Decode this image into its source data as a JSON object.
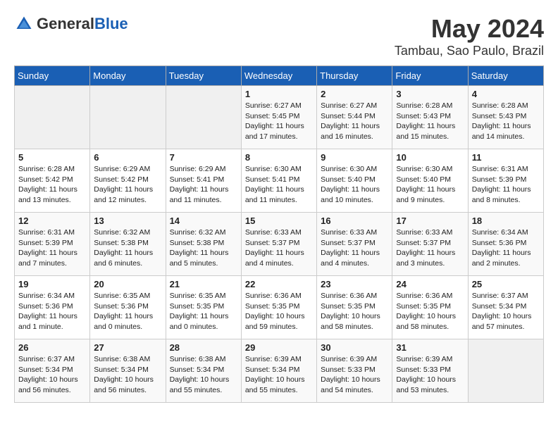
{
  "header": {
    "logo_general": "General",
    "logo_blue": "Blue",
    "month_title": "May 2024",
    "location": "Tambau, Sao Paulo, Brazil"
  },
  "days_of_week": [
    "Sunday",
    "Monday",
    "Tuesday",
    "Wednesday",
    "Thursday",
    "Friday",
    "Saturday"
  ],
  "weeks": [
    {
      "days": [
        {
          "number": "",
          "info": ""
        },
        {
          "number": "",
          "info": ""
        },
        {
          "number": "",
          "info": ""
        },
        {
          "number": "1",
          "info": "Sunrise: 6:27 AM\nSunset: 5:45 PM\nDaylight: 11 hours\nand 17 minutes."
        },
        {
          "number": "2",
          "info": "Sunrise: 6:27 AM\nSunset: 5:44 PM\nDaylight: 11 hours\nand 16 minutes."
        },
        {
          "number": "3",
          "info": "Sunrise: 6:28 AM\nSunset: 5:43 PM\nDaylight: 11 hours\nand 15 minutes."
        },
        {
          "number": "4",
          "info": "Sunrise: 6:28 AM\nSunset: 5:43 PM\nDaylight: 11 hours\nand 14 minutes."
        }
      ]
    },
    {
      "days": [
        {
          "number": "5",
          "info": "Sunrise: 6:28 AM\nSunset: 5:42 PM\nDaylight: 11 hours\nand 13 minutes."
        },
        {
          "number": "6",
          "info": "Sunrise: 6:29 AM\nSunset: 5:42 PM\nDaylight: 11 hours\nand 12 minutes."
        },
        {
          "number": "7",
          "info": "Sunrise: 6:29 AM\nSunset: 5:41 PM\nDaylight: 11 hours\nand 11 minutes."
        },
        {
          "number": "8",
          "info": "Sunrise: 6:30 AM\nSunset: 5:41 PM\nDaylight: 11 hours\nand 11 minutes."
        },
        {
          "number": "9",
          "info": "Sunrise: 6:30 AM\nSunset: 5:40 PM\nDaylight: 11 hours\nand 10 minutes."
        },
        {
          "number": "10",
          "info": "Sunrise: 6:30 AM\nSunset: 5:40 PM\nDaylight: 11 hours\nand 9 minutes."
        },
        {
          "number": "11",
          "info": "Sunrise: 6:31 AM\nSunset: 5:39 PM\nDaylight: 11 hours\nand 8 minutes."
        }
      ]
    },
    {
      "days": [
        {
          "number": "12",
          "info": "Sunrise: 6:31 AM\nSunset: 5:39 PM\nDaylight: 11 hours\nand 7 minutes."
        },
        {
          "number": "13",
          "info": "Sunrise: 6:32 AM\nSunset: 5:38 PM\nDaylight: 11 hours\nand 6 minutes."
        },
        {
          "number": "14",
          "info": "Sunrise: 6:32 AM\nSunset: 5:38 PM\nDaylight: 11 hours\nand 5 minutes."
        },
        {
          "number": "15",
          "info": "Sunrise: 6:33 AM\nSunset: 5:37 PM\nDaylight: 11 hours\nand 4 minutes."
        },
        {
          "number": "16",
          "info": "Sunrise: 6:33 AM\nSunset: 5:37 PM\nDaylight: 11 hours\nand 4 minutes."
        },
        {
          "number": "17",
          "info": "Sunrise: 6:33 AM\nSunset: 5:37 PM\nDaylight: 11 hours\nand 3 minutes."
        },
        {
          "number": "18",
          "info": "Sunrise: 6:34 AM\nSunset: 5:36 PM\nDaylight: 11 hours\nand 2 minutes."
        }
      ]
    },
    {
      "days": [
        {
          "number": "19",
          "info": "Sunrise: 6:34 AM\nSunset: 5:36 PM\nDaylight: 11 hours\nand 1 minute."
        },
        {
          "number": "20",
          "info": "Sunrise: 6:35 AM\nSunset: 5:36 PM\nDaylight: 11 hours\nand 0 minutes."
        },
        {
          "number": "21",
          "info": "Sunrise: 6:35 AM\nSunset: 5:35 PM\nDaylight: 11 hours\nand 0 minutes."
        },
        {
          "number": "22",
          "info": "Sunrise: 6:36 AM\nSunset: 5:35 PM\nDaylight: 10 hours\nand 59 minutes."
        },
        {
          "number": "23",
          "info": "Sunrise: 6:36 AM\nSunset: 5:35 PM\nDaylight: 10 hours\nand 58 minutes."
        },
        {
          "number": "24",
          "info": "Sunrise: 6:36 AM\nSunset: 5:35 PM\nDaylight: 10 hours\nand 58 minutes."
        },
        {
          "number": "25",
          "info": "Sunrise: 6:37 AM\nSunset: 5:34 PM\nDaylight: 10 hours\nand 57 minutes."
        }
      ]
    },
    {
      "days": [
        {
          "number": "26",
          "info": "Sunrise: 6:37 AM\nSunset: 5:34 PM\nDaylight: 10 hours\nand 56 minutes."
        },
        {
          "number": "27",
          "info": "Sunrise: 6:38 AM\nSunset: 5:34 PM\nDaylight: 10 hours\nand 56 minutes."
        },
        {
          "number": "28",
          "info": "Sunrise: 6:38 AM\nSunset: 5:34 PM\nDaylight: 10 hours\nand 55 minutes."
        },
        {
          "number": "29",
          "info": "Sunrise: 6:39 AM\nSunset: 5:34 PM\nDaylight: 10 hours\nand 55 minutes."
        },
        {
          "number": "30",
          "info": "Sunrise: 6:39 AM\nSunset: 5:33 PM\nDaylight: 10 hours\nand 54 minutes."
        },
        {
          "number": "31",
          "info": "Sunrise: 6:39 AM\nSunset: 5:33 PM\nDaylight: 10 hours\nand 53 minutes."
        },
        {
          "number": "",
          "info": ""
        }
      ]
    }
  ]
}
